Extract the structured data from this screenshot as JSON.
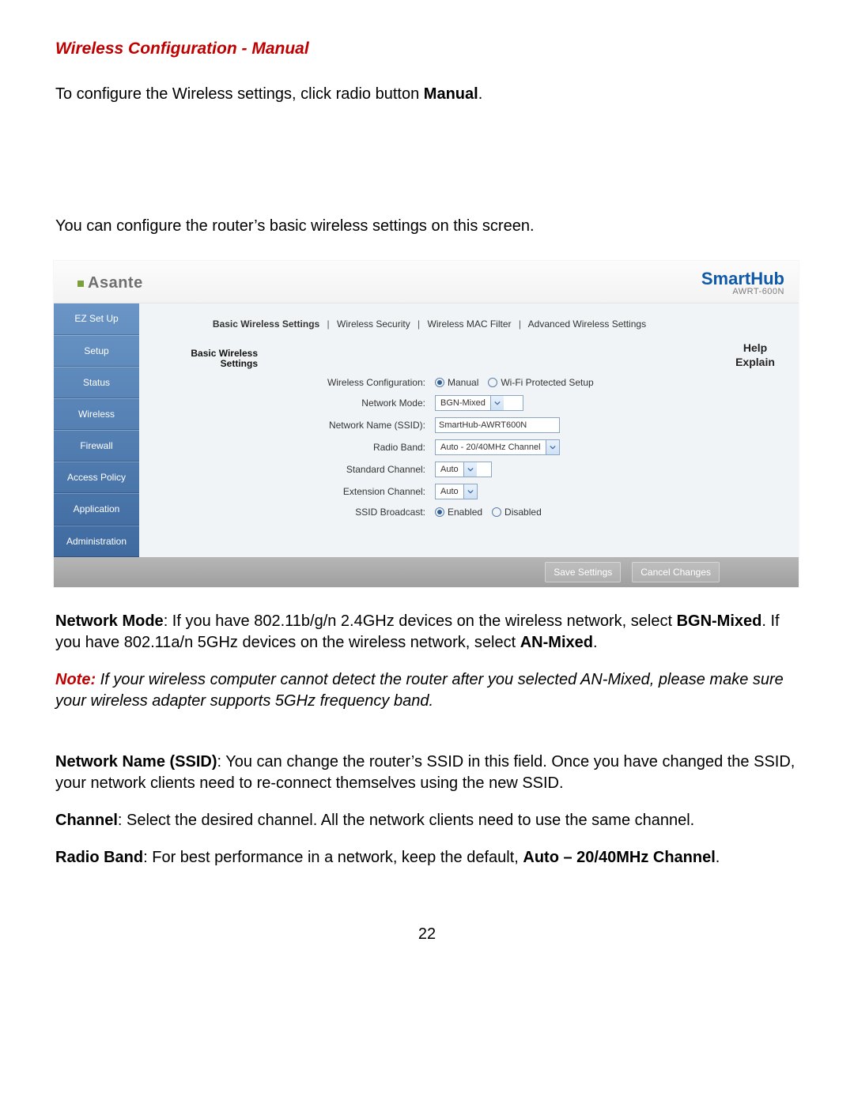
{
  "page_number": "22",
  "title": "Wireless Configuration - Manual",
  "intro1_a": "To configure the Wireless settings, click radio button ",
  "intro1_b": "Manual",
  "intro1_c": ".",
  "intro2": "You can configure the router’s basic wireless settings on this screen.",
  "router": {
    "logo_text": "Asante",
    "brand": "SmartHub",
    "model": "AWRT-600N",
    "nav": {
      "ez": "EZ Set Up",
      "setup": "Setup",
      "status": "Status",
      "wireless": "Wireless",
      "firewall": "Firewall",
      "access": "Access Policy",
      "application": "Application",
      "admin": "Administration"
    },
    "tabs": {
      "basic": "Basic Wireless Settings",
      "security": "Wireless Security",
      "mac": "Wireless MAC Filter",
      "advanced": "Advanced Wireless Settings",
      "sep": "|"
    },
    "section_label_line1": "Basic Wireless",
    "section_label_line2": "Settings",
    "labels": {
      "wcfg": "Wireless Configuration:",
      "mode": "Network Mode:",
      "ssid": "Network Name (SSID):",
      "band": "Radio Band:",
      "stdch": "Standard Channel:",
      "extch": "Extension Channel:",
      "bcast": "SSID Broadcast:"
    },
    "values": {
      "manual": "Manual",
      "wps": "Wi-Fi Protected Setup",
      "mode": "BGN-Mixed",
      "ssid": "SmartHub-AWRT600N",
      "band": "Auto - 20/40MHz Channel",
      "stdch": "Auto",
      "extch": "Auto",
      "enabled": "Enabled",
      "disabled": "Disabled"
    },
    "help_line1": "Help",
    "help_line2": "Explain",
    "save": "Save Settings",
    "cancel": "Cancel Changes"
  },
  "body": {
    "nm_b1": "Network Mode",
    "nm_t1": ": If you have 802.11b/g/n 2.4GHz devices on the wireless network, select ",
    "nm_b2": "BGN-Mixed",
    "nm_t2": ". If you have 802.11a/n 5GHz devices on the wireless network, select ",
    "nm_b3": "AN-Mixed",
    "nm_t3": ".",
    "note_word": "Note:",
    "note_body": " If your wireless computer cannot detect the router after you selected AN-Mixed, please make sure your wireless adapter supports 5GHz frequency band.",
    "ssid_b": "Network Name (SSID)",
    "ssid_t": ": You can change the router’s SSID in this field. Once you have changed the SSID, your network clients need to re-connect themselves using the new SSID.",
    "ch_b": "Channel",
    "ch_t": ": Select the desired channel. All the network clients need to use the same channel.",
    "rb_b1": "Radio Band",
    "rb_t1": ": For best performance in a network, keep the default, ",
    "rb_b2": "Auto – 20/40MHz Channel",
    "rb_t2": "."
  }
}
